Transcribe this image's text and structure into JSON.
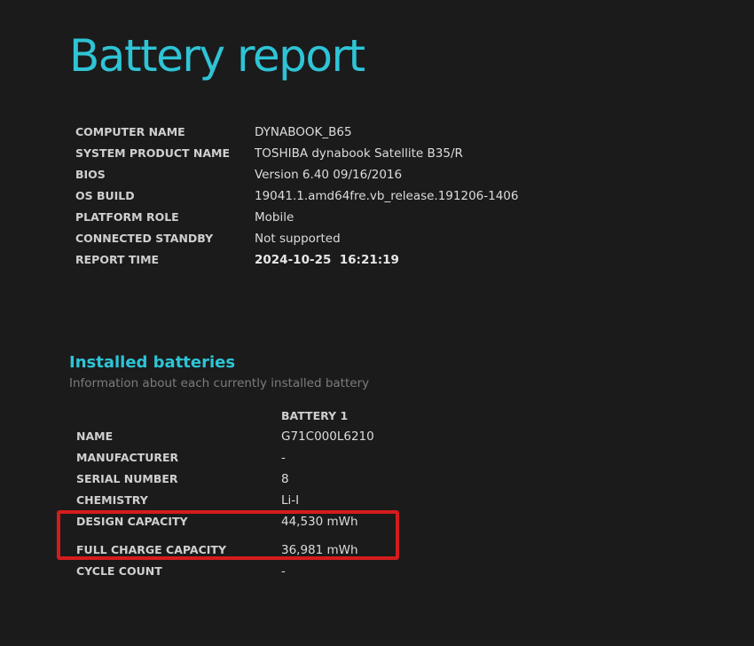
{
  "title": "Battery report",
  "system_info": [
    {
      "label": "COMPUTER NAME",
      "value": "DYNABOOK_B65"
    },
    {
      "label": "SYSTEM PRODUCT NAME",
      "value": "TOSHIBA dynabook Satellite B35/R"
    },
    {
      "label": "BIOS",
      "value": "Version 6.40 09/16/2016"
    },
    {
      "label": "OS BUILD",
      "value": "19041.1.amd64fre.vb_release.191206-1406"
    },
    {
      "label": "PLATFORM ROLE",
      "value": "Mobile"
    },
    {
      "label": "CONNECTED STANDBY",
      "value": "Not supported"
    },
    {
      "label": "REPORT TIME",
      "value": "2024-10-25  16:21:19"
    }
  ],
  "installed_batteries": {
    "title": "Installed batteries",
    "subtitle": "Information about each currently installed battery",
    "column_header": "BATTERY 1",
    "rows": [
      {
        "label": "NAME",
        "value": "G71C000L6210"
      },
      {
        "label": "MANUFACTURER",
        "value": "-"
      },
      {
        "label": "SERIAL NUMBER",
        "value": "8"
      },
      {
        "label": "CHEMISTRY",
        "value": "Li-I"
      },
      {
        "label": "DESIGN CAPACITY",
        "value": "44,530 mWh"
      },
      {
        "label": "FULL CHARGE CAPACITY",
        "value": "36,981 mWh"
      },
      {
        "label": "CYCLE COUNT",
        "value": "-"
      }
    ]
  },
  "colors": {
    "background": "#1b1b1b",
    "accent": "#2ec4d6",
    "highlight": "#d41c1c"
  }
}
